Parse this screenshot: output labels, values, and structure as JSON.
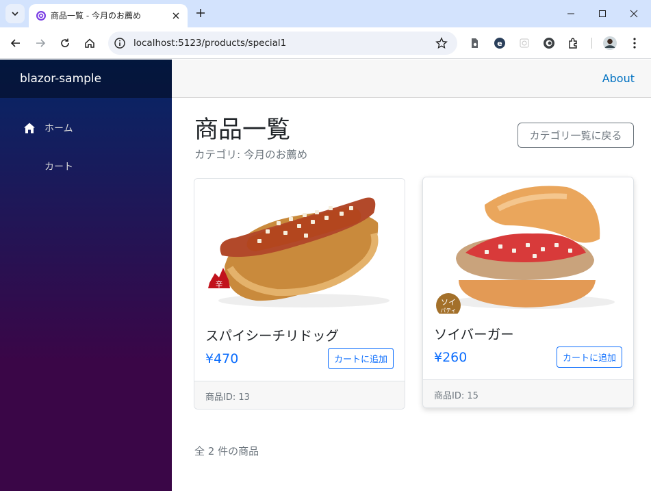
{
  "browser": {
    "tab_title": "商品一覧 - 今月のお薦め",
    "url": "localhost:5123/products/special1"
  },
  "sidebar": {
    "brand": "blazor-sample",
    "items": [
      {
        "label": "ホーム",
        "icon": "home-icon"
      },
      {
        "label": "カート"
      }
    ]
  },
  "topbar": {
    "about": "About"
  },
  "page": {
    "title": "商品一覧",
    "subtitle": "カテゴリ: 今月のお薦め",
    "back_button": "カテゴリ一覧に戻る",
    "total": "全 2 件の商品"
  },
  "products": [
    {
      "name": "スパイシーチリドッグ",
      "price": "¥470",
      "add_label": "カートに追加",
      "id_text": "商品ID: 13",
      "badge": "辛"
    },
    {
      "name": "ソイバーガー",
      "price": "¥260",
      "add_label": "カートに追加",
      "id_text": "商品ID: 15",
      "badge": "ソイ",
      "badge_sub": "パティ"
    }
  ],
  "colors": {
    "accent": "#0d6efd",
    "link": "#0071c1",
    "sidebar_top": "#052767",
    "sidebar_bottom": "#3a0647"
  }
}
